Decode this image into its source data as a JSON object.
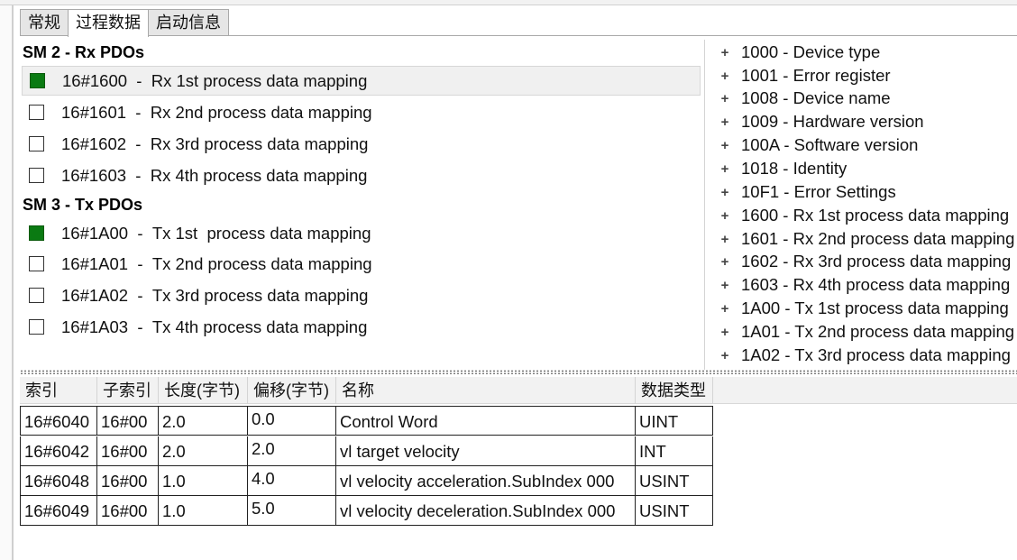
{
  "tabs": [
    {
      "label": "常规"
    },
    {
      "label": "过程数据"
    },
    {
      "label": "启动信息"
    }
  ],
  "active_tab": "过程数据",
  "rx_section": {
    "header": "SM 2 - Rx PDOs",
    "items": [
      {
        "index": "16#1600",
        "name": "Rx 1st process data mapping",
        "checked": true
      },
      {
        "index": "16#1601",
        "name": "Rx 2nd process data mapping",
        "checked": false
      },
      {
        "index": "16#1602",
        "name": "Rx 3rd process data mapping",
        "checked": false
      },
      {
        "index": "16#1603",
        "name": "Rx 4th process data mapping",
        "checked": false
      }
    ]
  },
  "tx_section": {
    "header": "SM 3 - Tx PDOs",
    "items": [
      {
        "index": "16#1A00",
        "name": "Tx 1st  process data mapping",
        "checked": true
      },
      {
        "index": "16#1A01",
        "name": "Tx 2nd process data mapping",
        "checked": false
      },
      {
        "index": "16#1A02",
        "name": "Tx 3rd process data mapping",
        "checked": false
      },
      {
        "index": "16#1A03",
        "name": "Tx 4th process data mapping",
        "checked": false
      }
    ]
  },
  "object_dictionary": [
    "1000 - Device type",
    "1001 - Error register",
    "1008 - Device name",
    "1009 - Hardware version",
    "100A - Software version",
    "1018 - Identity",
    "10F1 - Error Settings",
    "1600 - Rx 1st process data mapping",
    "1601 - Rx 2nd process data mapping",
    "1602 - Rx 3rd process data mapping",
    "1603 - Rx 4th process data mapping",
    "1A00 - Tx 1st  process data mapping",
    "1A01 - Tx 2nd process data mapping",
    "1A02 - Tx 3rd process data mapping"
  ],
  "table": {
    "columns": [
      "索引",
      "子索引",
      "长度(字节)",
      "偏移(字节)",
      "名称",
      "数据类型"
    ],
    "rows": [
      [
        "16#6040",
        "16#00",
        "2.0",
        "0.0",
        "Control Word",
        "UINT"
      ],
      [
        "16#6042",
        "16#00",
        "2.0",
        "2.0",
        "vl target velocity",
        "INT"
      ],
      [
        "16#6048",
        "16#00",
        "1.0",
        "4.0",
        "vl velocity acceleration.SubIndex 000",
        "USINT"
      ],
      [
        "16#6049",
        "16#00",
        "1.0",
        "5.0",
        "vl velocity deceleration.SubIndex 000",
        "USINT"
      ]
    ]
  },
  "colors": {
    "checked_fill": "#0a7a12",
    "selected_row": "#f0f0f0"
  },
  "icons": {
    "od_expand": "plus-icon"
  }
}
